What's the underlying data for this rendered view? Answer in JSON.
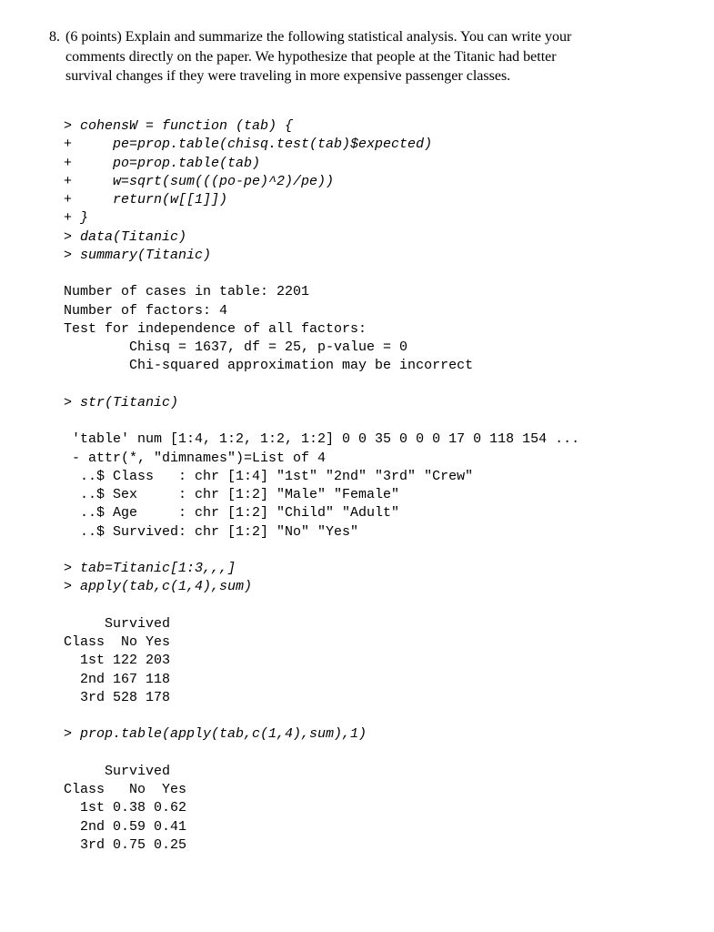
{
  "question": {
    "number": "8.",
    "points": "(6 points)",
    "text_a": "Explain and summarize the following statistical analysis. You can write your",
    "text_b": "comments directly on the paper. We hypothesize that people at the Titanic had better",
    "text_c": "survival changes if they were traveling in more expensive passenger classes."
  },
  "code": {
    "l01": "> cohensW = function (tab) {",
    "l02": "+     pe=prop.table(chisq.test(tab)$expected)",
    "l03": "+     po=prop.table(tab)",
    "l04": "+     w=sqrt(sum(((po-pe)^2)/pe))",
    "l05": "+     return(w[[1]])",
    "l06": "+ }",
    "l07": "> data(Titanic)",
    "l08": "> summary(Titanic)",
    "l09": "Number of cases in table: 2201",
    "l10": "Number of factors: 4",
    "l11": "Test for independence of all factors:",
    "l12": "        Chisq = 1637, df = 25, p-value = 0",
    "l13": "        Chi-squared approximation may be incorrect",
    "l14": "> str(Titanic)",
    "l15": " 'table' num [1:4, 1:2, 1:2, 1:2] 0 0 35 0 0 0 17 0 118 154 ...",
    "l16": " - attr(*, \"dimnames\")=List of 4",
    "l17": "  ..$ Class   : chr [1:4] \"1st\" \"2nd\" \"3rd\" \"Crew\"",
    "l18": "  ..$ Sex     : chr [1:2] \"Male\" \"Female\"",
    "l19": "  ..$ Age     : chr [1:2] \"Child\" \"Adult\"",
    "l20": "  ..$ Survived: chr [1:2] \"No\" \"Yes\"",
    "l21": "> tab=Titanic[1:3,,,]",
    "l22": "> apply(tab,c(1,4),sum)",
    "l23": "     Survived",
    "l24": "Class  No Yes",
    "l25": "  1st 122 203",
    "l26": "  2nd 167 118",
    "l27": "  3rd 528 178",
    "l28": "> prop.table(apply(tab,c(1,4),sum),1)",
    "l29": "     Survived",
    "l30": "Class   No  Yes",
    "l31": "  1st 0.38 0.62",
    "l32": "  2nd 0.59 0.41",
    "l33": "  3rd 0.75 0.25"
  }
}
